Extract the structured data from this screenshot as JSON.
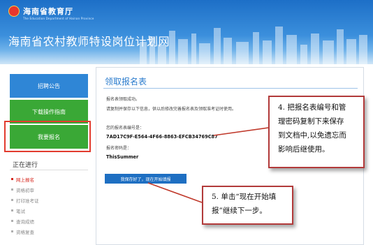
{
  "header": {
    "logo_text": "海南省教育厅",
    "logo_subtitle": "The Education Department of Hainan Province",
    "site_title": "海南省农村教师特设岗位计划网"
  },
  "sidebar": {
    "buttons": [
      {
        "label": "招聘公告",
        "color": "#2f86d6"
      },
      {
        "label": "下载操作指南",
        "color": "#3aa836"
      },
      {
        "label": "我要报名",
        "color": "#3aa836"
      }
    ],
    "progress_title": "正在进行",
    "steps": [
      {
        "label": "网上报名",
        "active": true
      },
      {
        "label": "资格初审",
        "active": false
      },
      {
        "label": "打印准考证",
        "active": false
      },
      {
        "label": "笔试",
        "active": false
      },
      {
        "label": "查询成绩",
        "active": false
      },
      {
        "label": "资格复查",
        "active": false
      }
    ]
  },
  "panel": {
    "title": "领取报名表",
    "success_msg": "报名表领取成功。",
    "instruction": "请复制并保存以下信息，供以后修改完善报名表及领取准考证时使用。",
    "number_label": "您的报名表编号是：",
    "number_value": "7AD17C9F-E564-4F66-8863-EFCB34769C87",
    "password_label": "报名密码是：",
    "password_value": "ThisSummer",
    "confirm_button": "我保存好了，现在开始填报"
  },
  "annotations": {
    "callout1": [
      "4. 把报名表编号和管",
      "理密码复制下来保存",
      "到文档中,以免遗忘而",
      "影响后继使用。"
    ],
    "callout2": [
      "5. 单击“现在开始填",
      "报”继续下一步。"
    ],
    "border_color": "#b23a3a"
  }
}
